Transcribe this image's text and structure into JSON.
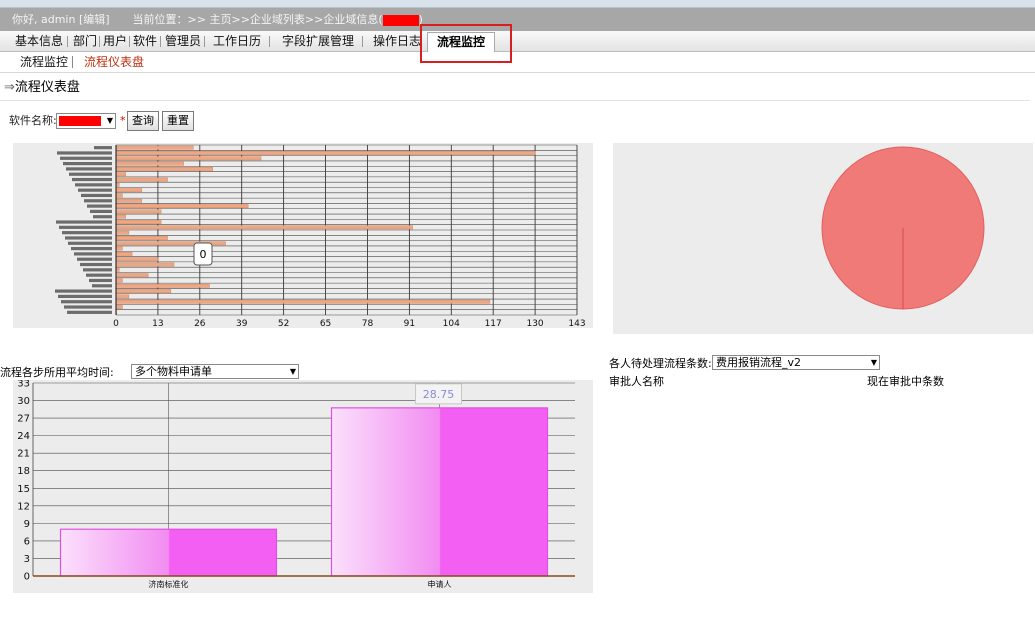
{
  "header": {
    "greeting": "你好, admin [编辑]",
    "location": "当前位置：>> 主页>>企业域列表>>企业域信息("
  },
  "nav": {
    "items": [
      "基本信息",
      "部门",
      "用户",
      "软件",
      "管理员",
      "工作日历",
      "字段扩展管理",
      "操作日志"
    ],
    "active": "流程监控"
  },
  "subnav": {
    "item1": "流程监控",
    "item2": "流程仪表盘"
  },
  "page_title": {
    "prefix": "⇒",
    "text": "流程仪表盘"
  },
  "filter": {
    "software_label": "软件名称:",
    "query_button": "查询",
    "reset_button": "重置",
    "required_mark": "*"
  },
  "avg_time": {
    "label": "流程各步所用平均时间:",
    "selected": "多个物料申请单"
  },
  "pending": {
    "label": "各人待处理流程条数:",
    "selected": "费用报销流程_v2",
    "col_name": "审批人名称",
    "col_count": "现在审批中条数"
  },
  "chart_data": [
    {
      "type": "bar",
      "orientation": "horizontal",
      "values": [
        24,
        130,
        45,
        21,
        30,
        3,
        16,
        1,
        8,
        2,
        8,
        41,
        14,
        3,
        14,
        92,
        4,
        16,
        34,
        2,
        5,
        13,
        18,
        1,
        10,
        2,
        29,
        17,
        4,
        116,
        2,
        0
      ],
      "xlim": [
        0,
        143
      ],
      "xticks": [
        "0",
        "13",
        "26",
        "39",
        "52",
        "65",
        "78",
        "91",
        "104",
        "117",
        "130",
        "143"
      ],
      "tooltip": "0",
      "grid": true
    },
    {
      "type": "pie",
      "slices": [
        100
      ],
      "colors": [
        "#f07a78"
      ]
    },
    {
      "type": "bar",
      "categories": [
        "济南标准化",
        "申请人"
      ],
      "values": [
        8,
        28.75
      ],
      "ylim": [
        0,
        33
      ],
      "yticks": [
        "0",
        "3",
        "6",
        "9",
        "12",
        "15",
        "18",
        "21",
        "24",
        "27",
        "30",
        "33"
      ],
      "value_label": "28.75",
      "grid": true
    }
  ]
}
